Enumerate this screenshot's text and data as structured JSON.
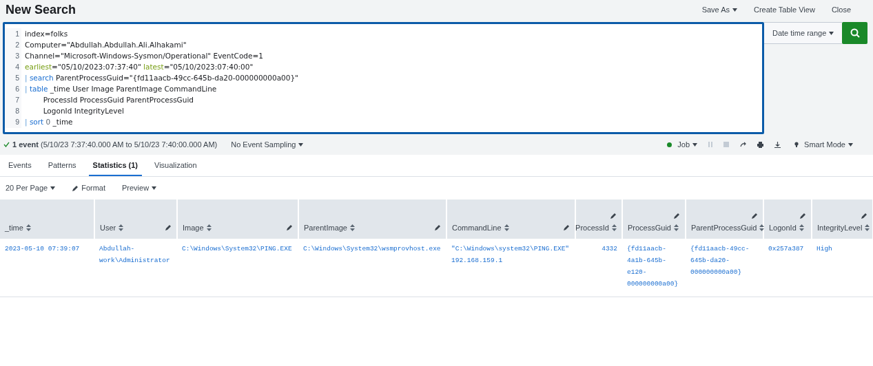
{
  "header": {
    "title": "New Search",
    "actions": [
      {
        "label": "Save As",
        "dropdown": true
      },
      {
        "label": "Create Table View",
        "dropdown": false
      },
      {
        "label": "Close",
        "dropdown": false
      }
    ]
  },
  "editor": {
    "lines": [
      [
        {
          "kind": "text",
          "text": "index=folks"
        }
      ],
      [
        {
          "kind": "text",
          "text": "Computer=\"Abdullah.Abdullah.Ali.Alhakami\""
        }
      ],
      [
        {
          "kind": "text",
          "text": "Channel=\"Microsoft-Windows-Sysmon/Operational\" EventCode=1"
        }
      ],
      [
        {
          "kind": "modifier",
          "text": "earliest"
        },
        {
          "kind": "text",
          "text": "=\"05/10/2023:07:37:40\" "
        },
        {
          "kind": "modifier",
          "text": "latest"
        },
        {
          "kind": "text",
          "text": "=\"05/10/2023:07:40:00\""
        }
      ],
      [
        {
          "kind": "pipe",
          "text": "| "
        },
        {
          "kind": "command",
          "text": "search"
        },
        {
          "kind": "text",
          "text": " ParentProcessGuid=\"{fd11aacb-49cc-645b-da20-000000000a00}\""
        }
      ],
      [
        {
          "kind": "pipe",
          "text": "| "
        },
        {
          "kind": "command",
          "text": "table"
        },
        {
          "kind": "text",
          "text": " _time User Image ParentImage CommandLine"
        }
      ],
      [
        {
          "kind": "text",
          "text": "        ProcessId ProcessGuid ParentProcessGuid"
        }
      ],
      [
        {
          "kind": "text",
          "text": "        LogonId IntegrityLevel"
        }
      ],
      [
        {
          "kind": "pipe",
          "text": "| "
        },
        {
          "kind": "command",
          "text": "sort"
        },
        {
          "kind": "number",
          "text": " 0"
        },
        {
          "kind": "text",
          "text": " _time"
        }
      ]
    ],
    "line_numbers": [
      "1",
      "2",
      "3",
      "4",
      "5",
      "6",
      "7",
      "8",
      "9"
    ]
  },
  "time_picker": {
    "label": "Date time range"
  },
  "status": {
    "summary": "**1 event** (5/10/23 7:37:40.000 AM to 5/10/23 7:40:00.000 AM)",
    "sampling": "No Event Sampling",
    "job": "Job",
    "mode": "Smart Mode"
  },
  "tabs": [
    {
      "label": "Events",
      "selected": false
    },
    {
      "label": "Patterns",
      "selected": false
    },
    {
      "label": "Statistics (1)",
      "selected": true
    },
    {
      "label": "Visualization",
      "selected": false
    }
  ],
  "toolbar": {
    "per_page": "20 Per Page",
    "format": "Format",
    "preview": "Preview"
  },
  "table": {
    "columns": [
      {
        "label": "_time",
        "editable": false,
        "kind": "text"
      },
      {
        "label": "User",
        "editable": true,
        "kind": "text"
      },
      {
        "label": "Image",
        "editable": true,
        "kind": "text"
      },
      {
        "label": "ParentImage",
        "editable": true,
        "kind": "text"
      },
      {
        "label": "CommandLine",
        "editable": true,
        "kind": "text"
      },
      {
        "label": "ProcessId",
        "editable": true,
        "kind": "number"
      },
      {
        "label": "ProcessGuid",
        "editable": true,
        "kind": "text"
      },
      {
        "label": "ParentProcessGuid",
        "editable": true,
        "kind": "text"
      },
      {
        "label": "LogonId",
        "editable": true,
        "kind": "text"
      },
      {
        "label": "IntegrityLevel",
        "editable": true,
        "kind": "text"
      }
    ],
    "rows": [
      [
        "2023-05-10 07:39:07",
        "Abdullah-work\\Administrator",
        "C:\\Windows\\System32\\PING.EXE",
        "C:\\Windows\\System32\\wsmprovhost.exe",
        "\"C:\\Windows\\system32\\PING.EXE\" 192.168.159.1",
        "4332",
        "{fd11aacb-4a1b-645b-e120-000000000a00}",
        "{fd11aacb-49cc-645b-da20-000000000a00}",
        "0x257a387",
        "High"
      ]
    ]
  }
}
